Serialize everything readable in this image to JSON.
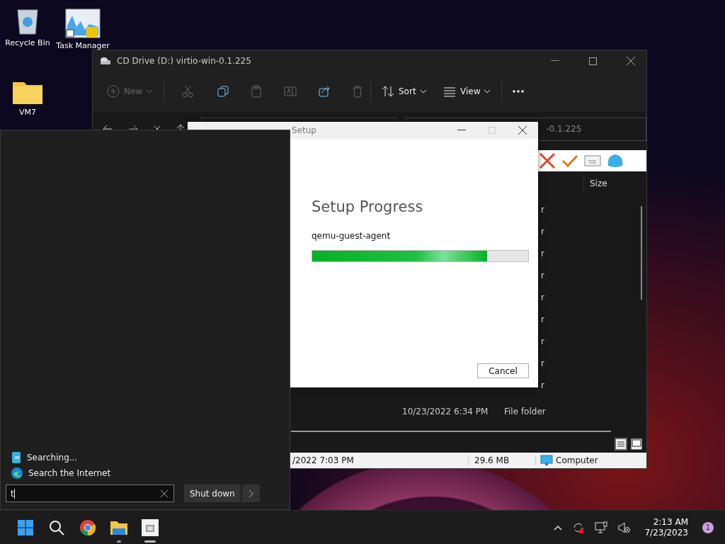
{
  "desktop_icons": [
    {
      "kind": "recycle",
      "label": "Recycle Bin"
    },
    {
      "kind": "taskmgr",
      "label": "Task Manager"
    },
    {
      "kind": "folder",
      "label": "VM7"
    }
  ],
  "explorer": {
    "title": "CD Drive (D:) virtio-win-0.1.225",
    "toolbar": [
      {
        "kind": "new",
        "label": "New",
        "disabled": true
      },
      {
        "kind": "cut",
        "disabled": true
      },
      {
        "kind": "copy",
        "disabled": false
      },
      {
        "kind": "paste",
        "disabled": true
      },
      {
        "kind": "rename",
        "disabled": true
      },
      {
        "kind": "share",
        "disabled": false
      },
      {
        "kind": "delete",
        "disabled": true
      },
      {
        "kind": "sort",
        "label": "Sort",
        "disabled": false
      },
      {
        "kind": "view",
        "label": "View",
        "disabled": false
      },
      {
        "kind": "more",
        "disabled": false
      }
    ],
    "search_value": "-0.1.225",
    "columns": [
      "Size"
    ],
    "type_fragments": [
      "r",
      "r",
      "r",
      "r",
      "r",
      "r",
      "r",
      "r",
      "r"
    ],
    "row": {
      "date": "10/23/2022 6:34 PM",
      "type": "File folder"
    },
    "status_bar": [
      "/2022 7:03 PM",
      "29.6 MB",
      "Computer"
    ]
  },
  "setup_dialog": {
    "title": "Setup",
    "heading": "Setup Progress",
    "component": "qemu-guest-agent",
    "level": 0.81,
    "button": "Cancel"
  },
  "start_menu": {
    "results": [
      {
        "kind": "searching",
        "label": "Searching..."
      },
      {
        "kind": "web",
        "label": "Search the Internet"
      }
    ],
    "search_value": "t",
    "power_button": "Shut down"
  },
  "taskbar": {
    "apps": [
      {
        "kind": "start",
        "running": false
      },
      {
        "kind": "search",
        "running": false
      },
      {
        "kind": "chrome",
        "running": false
      },
      {
        "kind": "explorer",
        "running": true
      },
      {
        "kind": "installer",
        "running": true
      }
    ],
    "time": "2:13 AM",
    "date": "7/23/2023",
    "notification_count": "1"
  }
}
